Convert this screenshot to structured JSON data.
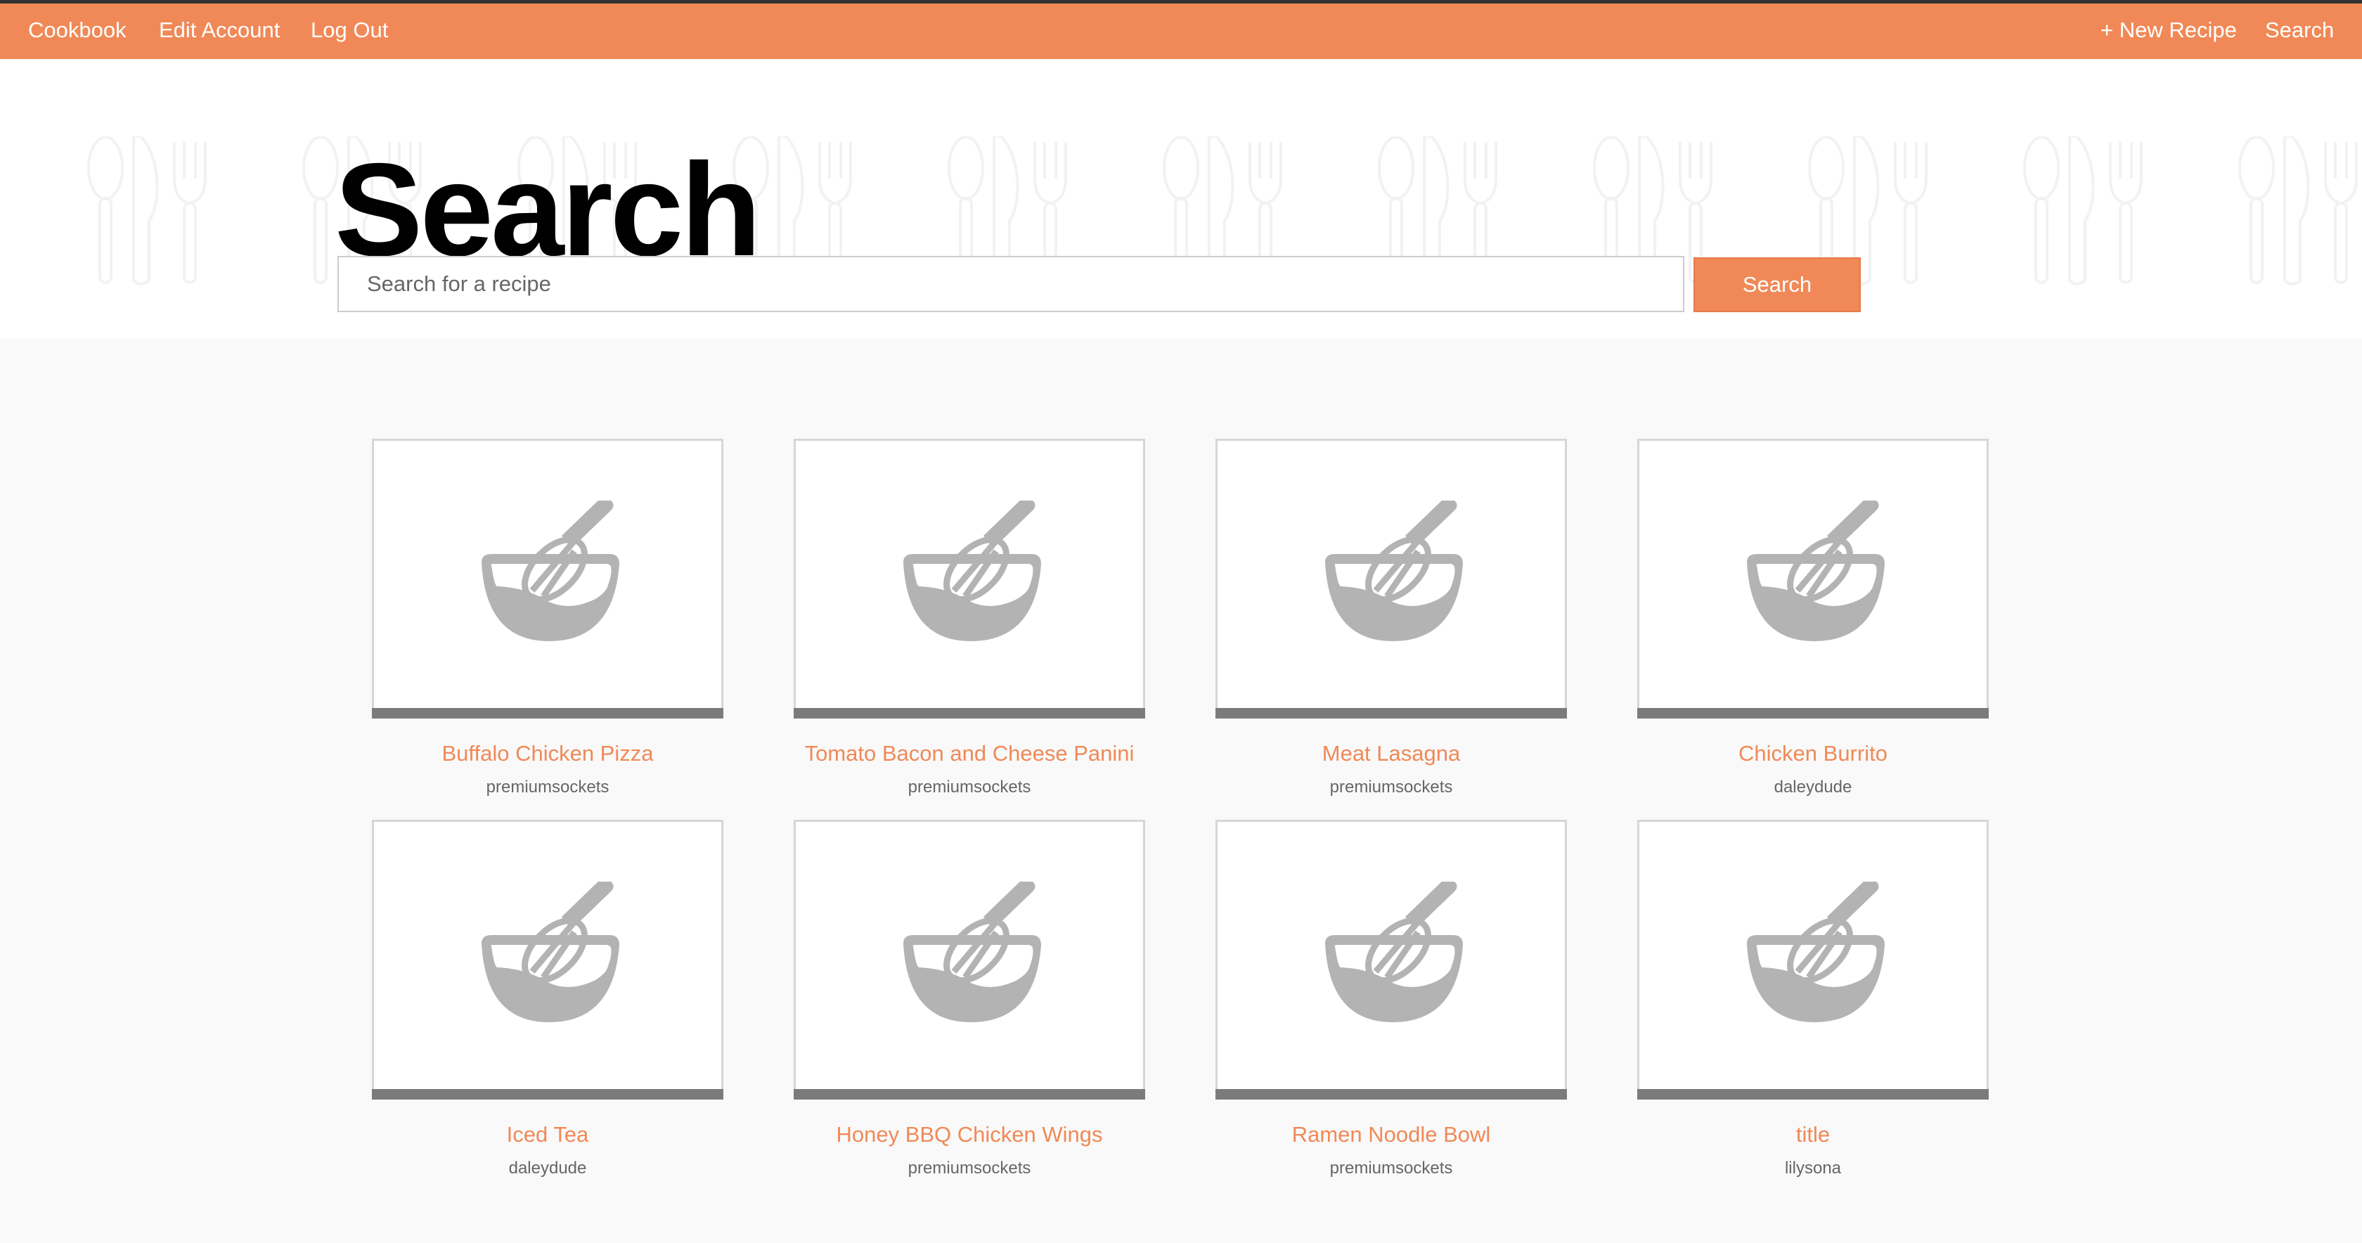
{
  "nav": {
    "left": [
      "Cookbook",
      "Edit Account",
      "Log Out"
    ],
    "new_recipe": "+ New Recipe",
    "search": "Search"
  },
  "page": {
    "title": "Search",
    "search_placeholder": "Search for a recipe",
    "search_value": "",
    "search_button": "Search"
  },
  "colors": {
    "accent": "#f08957",
    "icon": "#b3b3b3"
  },
  "recipes": [
    {
      "name": "Buffalo Chicken Pizza",
      "user": "premiumsockets",
      "icon": "whisk-bowl-icon"
    },
    {
      "name": "Tomato Bacon and Cheese Panini",
      "user": "premiumsockets",
      "icon": "whisk-bowl-icon"
    },
    {
      "name": "Meat Lasagna",
      "user": "premiumsockets",
      "icon": "whisk-bowl-icon"
    },
    {
      "name": "Chicken Burrito",
      "user": "daleydude",
      "icon": "whisk-bowl-icon"
    },
    {
      "name": "Iced Tea",
      "user": "daleydude",
      "icon": "whisk-bowl-icon"
    },
    {
      "name": "Honey BBQ Chicken Wings",
      "user": "premiumsockets",
      "icon": "whisk-bowl-icon"
    },
    {
      "name": "Ramen Noodle Bowl",
      "user": "premiumsockets",
      "icon": "whisk-bowl-icon"
    },
    {
      "name": "title",
      "user": "lilysona",
      "icon": "whisk-bowl-icon"
    }
  ]
}
